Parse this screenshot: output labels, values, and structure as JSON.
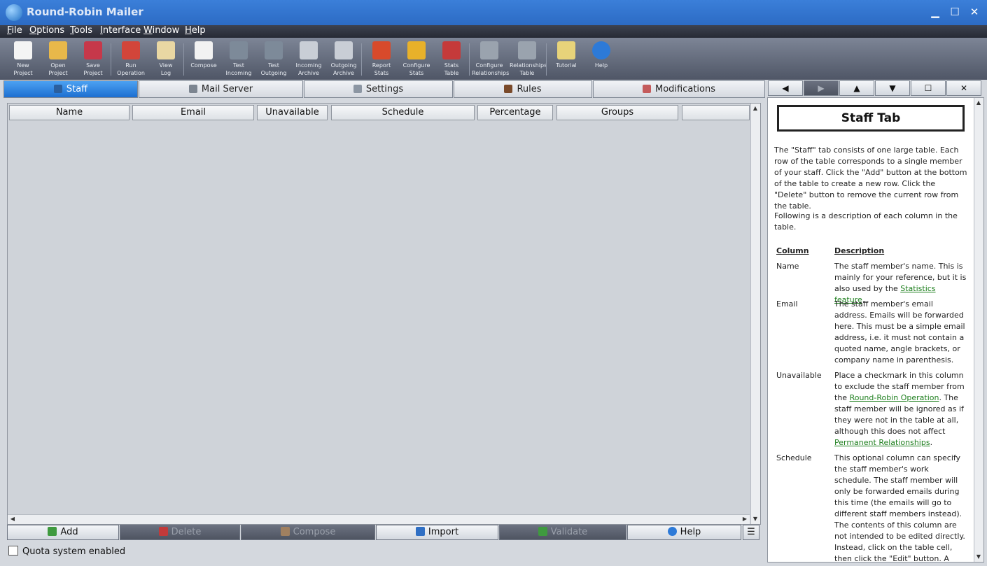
{
  "window": {
    "title": "Round-Robin Mailer",
    "controls": {
      "minimize": "▁",
      "maximize": "☐",
      "close": "✕"
    }
  },
  "menu": [
    "File",
    "Options",
    "Tools",
    "Interface",
    "Window",
    "Help"
  ],
  "toolbar": [
    {
      "label": "New\nProject",
      "icon": "new-project-icon",
      "color": "#f4f4f4"
    },
    {
      "label": "Open\nProject",
      "icon": "open-project-icon",
      "color": "#e8b84a"
    },
    {
      "label": "Save\nProject",
      "icon": "save-project-icon",
      "color": "#c6384a"
    },
    {
      "label": "Run\nOperation",
      "icon": "run-operation-icon",
      "color": "#d2453a"
    },
    {
      "label": "View\nLog",
      "icon": "view-log-icon",
      "color": "#e9d7a3"
    },
    {
      "label": "Compose",
      "icon": "compose-icon",
      "color": "#f2f2f2"
    },
    {
      "label": "Test\nIncoming",
      "icon": "test-incoming-icon",
      "color": "#7d8a99"
    },
    {
      "label": "Test\nOutgoing",
      "icon": "test-outgoing-icon",
      "color": "#7d8a99"
    },
    {
      "label": "Incoming\nArchive",
      "icon": "incoming-archive-icon",
      "color": "#c9ced6"
    },
    {
      "label": "Outgoing\nArchive",
      "icon": "outgoing-archive-icon",
      "color": "#c9ced6"
    },
    {
      "label": "Report\nStats",
      "icon": "report-stats-icon",
      "color": "#d84a2b"
    },
    {
      "label": "Configure\nStats",
      "icon": "configure-stats-icon",
      "color": "#e8b12a"
    },
    {
      "label": "Stats\nTable",
      "icon": "stats-table-icon",
      "color": "#c53a3a"
    },
    {
      "label": "Configure\nRelationships",
      "icon": "configure-relationships-icon",
      "color": "#9aa3ae"
    },
    {
      "label": "Relationships\nTable",
      "icon": "relationships-table-icon",
      "color": "#9aa3ae"
    },
    {
      "label": "Tutorial",
      "icon": "tutorial-icon",
      "color": "#e7d37a"
    },
    {
      "label": "Help",
      "icon": "help-icon",
      "color": "#2d7ad8"
    }
  ],
  "tabs": [
    {
      "label": "Staff",
      "icon": "staff-icon",
      "active": true
    },
    {
      "label": "Mail Server",
      "icon": "mail-server-icon",
      "active": false
    },
    {
      "label": "Settings",
      "icon": "settings-icon",
      "active": false
    },
    {
      "label": "Rules",
      "icon": "rules-icon",
      "active": false
    },
    {
      "label": "Modifications",
      "icon": "modifications-icon",
      "active": false
    }
  ],
  "table": {
    "columns": [
      "Name",
      "Email",
      "Unavailable",
      "Schedule",
      "Percentage",
      "Groups",
      ""
    ]
  },
  "buttons": [
    {
      "label": "Add",
      "icon": "add-icon",
      "enabled": true
    },
    {
      "label": "Delete",
      "icon": "delete-icon",
      "enabled": false
    },
    {
      "label": "Compose",
      "icon": "compose-icon",
      "enabled": false
    },
    {
      "label": "Import",
      "icon": "import-icon",
      "enabled": true
    },
    {
      "label": "Validate",
      "icon": "validate-icon",
      "enabled": false
    },
    {
      "label": "Help",
      "icon": "help-icon",
      "enabled": true
    }
  ],
  "quota_label": "Quota system enabled",
  "help_nav": {
    "back": "◀",
    "forward": "▶",
    "up": "▲",
    "down": "▼",
    "restore": "☐",
    "close": "✕"
  },
  "help": {
    "title": "Staff Tab",
    "intro": "The \"Staff\" tab consists of one large table.  Each row of the table corresponds to a single member of your staff.  Click the \"Add\" button at the bottom of the table to create a new row.  Click the \"Delete\" button to remove the current row from the table.",
    "following": "Following is a description of each column in the table.",
    "col_header": "Column",
    "desc_header": "Description",
    "name_term": "Name",
    "name_desc_a": "The staff member's name.  This is mainly for your reference, but it is also used by the ",
    "name_link": "Statistics feature",
    "name_desc_b": ".",
    "email_term": "Email",
    "email_desc": "The staff member's email address. Emails will be forwarded here.  This must be a simple email address, i.e. it must not contain a quoted name, angle brackets, or company name in parenthesis.",
    "unavail_term": "Unavailable",
    "unavail_desc_a": "Place a checkmark in this column to exclude the staff member from the ",
    "unavail_link1": "Round-Robin Operation",
    "unavail_desc_b": ".  The staff member will be ignored as if they were not in the table at all, although this does not affect ",
    "unavail_link2": "Permanent Relationships",
    "unavail_desc_c": ".",
    "sched_term": "Schedule",
    "sched_desc": "This optional column can specify the staff member's work schedule. The staff member will only be forwarded emails during this time (the emails will go to different staff members instead).  The contents of this column are not intended to be edited directly.  Instead, click on the table cell, then click the \"Edit\" button.  A popup window will"
  }
}
